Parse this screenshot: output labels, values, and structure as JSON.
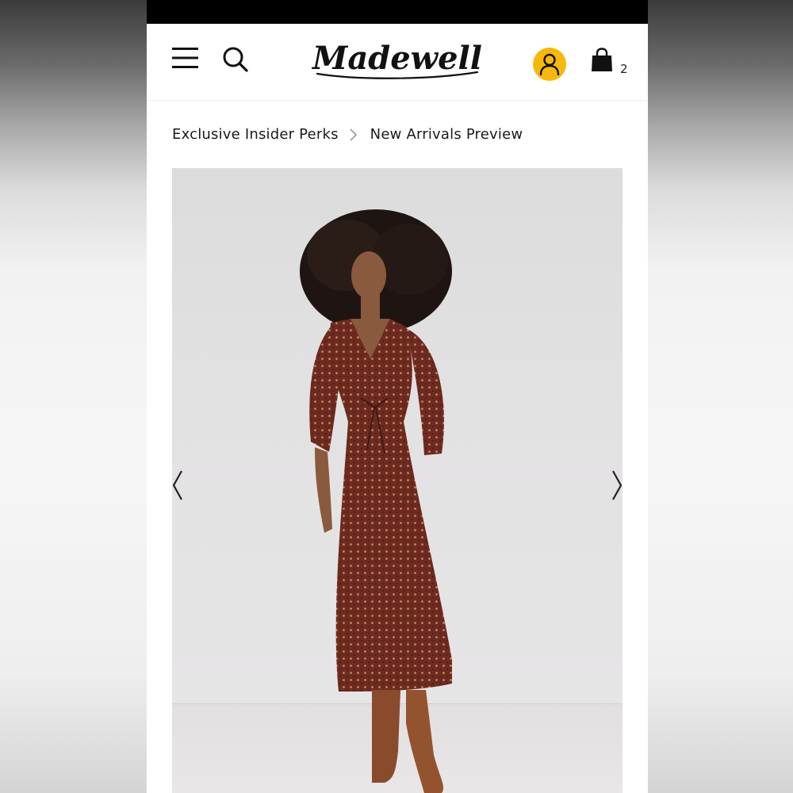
{
  "brand": {
    "logo_text": "Madewell",
    "accent_color": "#f6b90b"
  },
  "header": {
    "menu_icon": "hamburger-menu-icon",
    "search_icon": "search-icon",
    "account_icon": "user-account-icon",
    "bag_icon": "shopping-bag-icon",
    "bag_count": "2"
  },
  "breadcrumb": {
    "items": [
      "Exclusive Insider Perks",
      "New Arrivals Preview"
    ],
    "separator_icon": "chevron-right-icon"
  },
  "carousel": {
    "image_subject": "model wearing long-sleeve burgundy printed midi dress with brown knee-high boots",
    "prev_icon": "chevron-left-icon",
    "next_icon": "chevron-right-icon",
    "dress_color": "#6e2a20",
    "boot_color": "#8a4a2c"
  }
}
